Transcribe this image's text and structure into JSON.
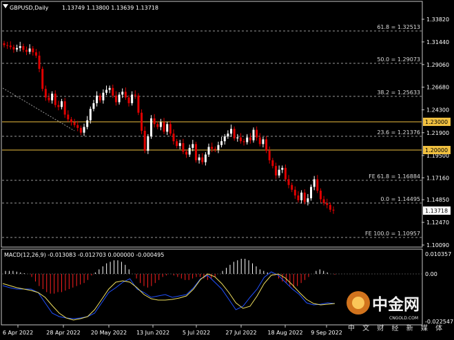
{
  "window": {
    "symbol_label": "GBPUSD,Daily",
    "ohlc_label": "1.13749 1.13800 1.13639 1.13718"
  },
  "colors": {
    "background": "#000000",
    "frame": "#c8c8c8",
    "bull_candle": "#ffffff",
    "bear_candle": "#e00000",
    "fib_line": "#9a9a9a",
    "level_line": "#f0c040",
    "macd_pos": "#ffffff",
    "macd_neg": "#ff2020",
    "macd_line": "#2050ff",
    "signal_line": "#f0e060"
  },
  "price_axis": {
    "ticks": [
      "1.33820",
      "1.31440",
      "1.29060",
      "1.26680",
      "1.24300",
      "1.21900",
      "1.19500",
      "1.17160",
      "1.14850",
      "1.12470",
      "1.10090"
    ],
    "current_price": "1.13718"
  },
  "levels": [
    {
      "kind": "fib",
      "label": "61.8 = 1.32513"
    },
    {
      "kind": "fib",
      "label": "50.0 = 1.29073"
    },
    {
      "kind": "fib",
      "label": "38.2 = 1.25633"
    },
    {
      "kind": "fib",
      "label": "23.6 = 1.21376"
    },
    {
      "kind": "fib",
      "label": "FE 61.8 = 1.16884"
    },
    {
      "kind": "fib",
      "label": "0.0 = 1.14495"
    },
    {
      "kind": "fib",
      "label": "FE 100.0 = 1.10957"
    },
    {
      "kind": "hline",
      "label": "1.23000"
    },
    {
      "kind": "hline",
      "label": "1.20000"
    }
  ],
  "macd": {
    "label": "MACD(12,26,9) -0.013083 -0.012703 0.000000 -0.000495",
    "axis_ticks": [
      "0.010357",
      "0.00",
      "-0.022547"
    ]
  },
  "time_axis": {
    "labels": [
      "6 Apr 2022",
      "28 Apr 2022",
      "20 May 2022",
      "13 Jun 2022",
      "5 Jul 2022",
      "27 Jul 2022",
      "18 Aug 2022",
      "9 Sep 2022"
    ]
  },
  "watermark": {
    "brand_cn": "中金网",
    "brand_site": "CNGOLD.COM",
    "brand_tagline": "中 文 财 经 新 媒 体"
  },
  "chart_data": {
    "type": "candlestick",
    "price_series": [
      1.311,
      1.3105,
      1.309,
      1.3065,
      1.308,
      1.31,
      1.306,
      1.304,
      1.3075,
      1.3035,
      1.3,
      1.286,
      1.265,
      1.256,
      1.253,
      1.26,
      1.248,
      1.246,
      1.252,
      1.238,
      1.233,
      1.23,
      1.227,
      1.224,
      1.219,
      1.225,
      1.232,
      1.244,
      1.25,
      1.258,
      1.253,
      1.261,
      1.264,
      1.266,
      1.258,
      1.251,
      1.259,
      1.262,
      1.256,
      1.25,
      1.259,
      1.258,
      1.24,
      1.221,
      1.2,
      1.215,
      1.234,
      1.228,
      1.225,
      1.23,
      1.22,
      1.228,
      1.218,
      1.21,
      1.205,
      1.208,
      1.199,
      1.196,
      1.203,
      1.207,
      1.19,
      1.193,
      1.188,
      1.196,
      1.204,
      1.202,
      1.201,
      1.206,
      1.21,
      1.215,
      1.218,
      1.223,
      1.213,
      1.214,
      1.21,
      1.209,
      1.214,
      1.211,
      1.222,
      1.214,
      1.207,
      1.212,
      1.2,
      1.19,
      1.184,
      1.174,
      1.18,
      1.182,
      1.17,
      1.164,
      1.159,
      1.153,
      1.148,
      1.156,
      1.146,
      1.15,
      1.162,
      1.17,
      1.158,
      1.149,
      1.145,
      1.143,
      1.138,
      1.13718
    ],
    "macd_histogram": [
      0.002,
      0.002,
      0.002,
      0.0015,
      0.001,
      0.0005,
      0.0,
      -0.002,
      -0.005,
      -0.008,
      -0.01,
      -0.012,
      -0.013,
      -0.013,
      -0.012,
      -0.012,
      -0.011,
      -0.01,
      -0.009,
      -0.008,
      -0.007,
      -0.006,
      -0.004,
      -0.001,
      0.001,
      0.003,
      0.005,
      0.007,
      0.008,
      0.009,
      0.009,
      0.008,
      0.006,
      0.003,
      0.0,
      -0.003,
      -0.006,
      -0.008,
      -0.009,
      -0.008,
      -0.006,
      -0.004,
      -0.002,
      -0.001,
      0.0,
      -0.001,
      -0.002,
      -0.003,
      -0.004,
      -0.004,
      -0.003,
      -0.002,
      -0.002,
      -0.003,
      -0.004,
      -0.003,
      -0.002,
      0.0,
      0.002,
      0.004,
      0.006,
      0.008,
      0.009,
      0.01,
      0.01,
      0.009,
      0.007,
      0.005,
      0.003,
      0.002,
      0.001,
      0.0,
      -0.001,
      -0.003,
      -0.005,
      -0.006,
      -0.008,
      -0.009,
      -0.008,
      -0.006,
      -0.004,
      -0.002,
      0.0,
      0.002,
      0.003,
      0.002,
      0.001,
      0.0,
      -0.0005
    ]
  }
}
